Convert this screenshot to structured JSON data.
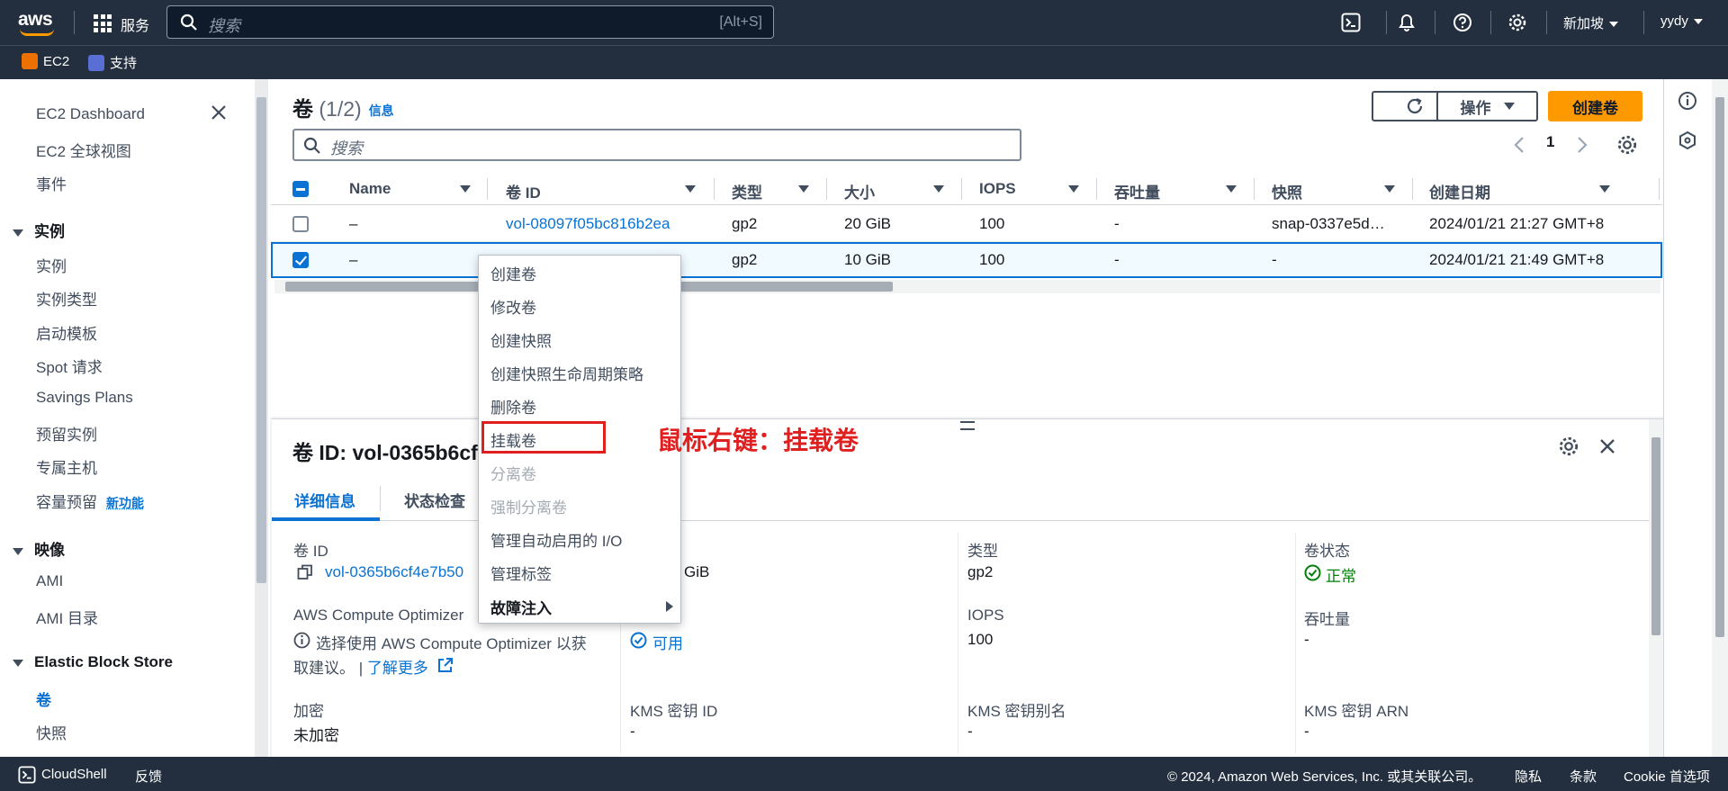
{
  "topbar": {
    "logo": "aws",
    "services_label": "服务",
    "search_placeholder": "搜索",
    "search_shortcut": "[Alt+S]",
    "region": "新加坡",
    "user": "yydy",
    "icons": [
      "cloudshell-icon",
      "bell-icon",
      "help-icon",
      "gear-icon"
    ]
  },
  "favorites": [
    {
      "label": "EC2",
      "color": "#ed7100"
    },
    {
      "label": "支持",
      "color": "#5a6fd6"
    }
  ],
  "sidebar": {
    "top_items": [
      "EC2 Dashboard",
      "EC2 全球视图",
      "事件"
    ],
    "groups": [
      {
        "title": "实例",
        "items": [
          "实例",
          "实例类型",
          "启动模板",
          "Spot 请求",
          "Savings Plans",
          "预留实例",
          "专属主机",
          "容量预留"
        ]
      },
      {
        "title": "映像",
        "items": [
          "AMI",
          "AMI 目录"
        ]
      },
      {
        "title": "Elastic Block Store",
        "items": [
          "卷",
          "快照"
        ]
      }
    ],
    "new_badge": "新功能"
  },
  "volumes": {
    "title": "卷",
    "count": "(1/2)",
    "info": "信息",
    "refresh_icon": "refresh-icon",
    "actions_label": "操作",
    "create_label": "创建卷",
    "search_placeholder": "搜索",
    "page": "1",
    "columns": [
      "Name",
      "卷 ID",
      "类型",
      "大小",
      "IOPS",
      "吞吐量",
      "快照",
      "创建日期"
    ],
    "rows": [
      {
        "name": "–",
        "id": "vol-08097f05bc816b2ea",
        "type": "gp2",
        "size": "20 GiB",
        "iops": "100",
        "throughput": "-",
        "snapshot": "snap-0337e5d…",
        "created": "2024/01/21 21:27 GMT+8",
        "selected": false
      },
      {
        "name": "–",
        "id": "",
        "type": "gp2",
        "size": "10 GiB",
        "iops": "100",
        "throughput": "-",
        "snapshot": "-",
        "created": "2024/01/21 21:49 GMT+8",
        "selected": true
      }
    ]
  },
  "context_menu": {
    "items": [
      {
        "label": "创建卷",
        "disabled": false
      },
      {
        "label": "修改卷",
        "disabled": false
      },
      {
        "label": "创建快照",
        "disabled": false
      },
      {
        "label": "创建快照生命周期策略",
        "disabled": false
      },
      {
        "label": "删除卷",
        "disabled": false
      },
      {
        "label": "挂载卷",
        "disabled": false
      },
      {
        "label": "分离卷",
        "disabled": true
      },
      {
        "label": "强制分离卷",
        "disabled": true
      },
      {
        "label": "管理自动启用的 I/O",
        "disabled": false
      },
      {
        "label": "管理标签",
        "disabled": false
      },
      {
        "label": "故障注入",
        "disabled": false
      }
    ],
    "annotation": "鼠标右键：挂载卷",
    "highlight_color": "#e02020"
  },
  "detail": {
    "title": "卷 ID: vol-0365b6cf",
    "tabs": [
      "详细信息",
      "状态检查"
    ],
    "fields": {
      "vol_id_label": "卷 ID",
      "vol_id_value": "vol-0365b6cf4e7b50",
      "size_value": "GiB",
      "type_label": "类型",
      "type_value": "gp2",
      "status_label": "卷状态",
      "status_value": "正常",
      "optimizer_label": "AWS Compute Optimizer",
      "optimizer_text_1": "选择使用 AWS Compute Optimizer 以获",
      "optimizer_text_2": "取建议。",
      "learn_more": "了解更多",
      "avail_value": "可用",
      "iops_label": "IOPS",
      "iops_value": "100",
      "throughput_label": "吞吐量",
      "throughput_value": "-",
      "enc_label": "加密",
      "enc_value": "未加密",
      "kms_id_label": "KMS 密钥 ID",
      "kms_id_value": "-",
      "kms_alias_label": "KMS 密钥别名",
      "kms_alias_value": "-",
      "kms_arn_label": "KMS 密钥 ARN",
      "kms_arn_value": "-"
    }
  },
  "footer": {
    "cloudshell": "CloudShell",
    "feedback": "反馈",
    "copyright": "© 2024, Amazon Web Services, Inc. 或其关联公司。",
    "privacy": "隐私",
    "terms": "条款",
    "cookies": "Cookie 首选项"
  }
}
